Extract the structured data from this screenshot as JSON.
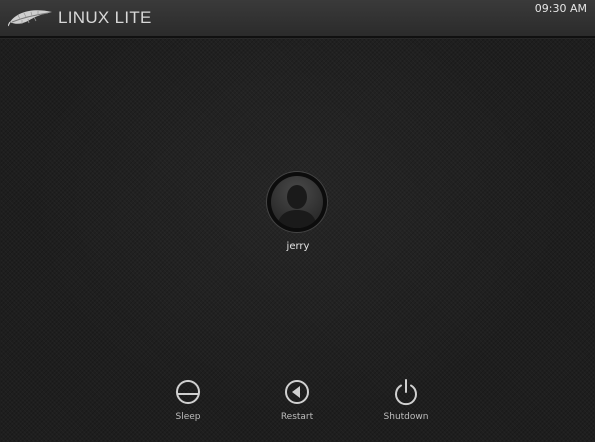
{
  "topbar": {
    "logo_text": "LINUX LITE",
    "logo_icon": "feather-icon",
    "clock": "09:30 AM"
  },
  "user": {
    "name": "jerry",
    "avatar_icon": "user-silhouette-icon"
  },
  "actions": [
    {
      "label": "Sleep",
      "icon": "sleep-icon"
    },
    {
      "label": "Restart",
      "icon": "restart-icon"
    },
    {
      "label": "Shutdown",
      "icon": "power-icon"
    }
  ],
  "colors": {
    "background": "#1e1e1e",
    "topbar": "#333333",
    "text": "#e4e4e4",
    "icon": "#d0d0d0"
  }
}
